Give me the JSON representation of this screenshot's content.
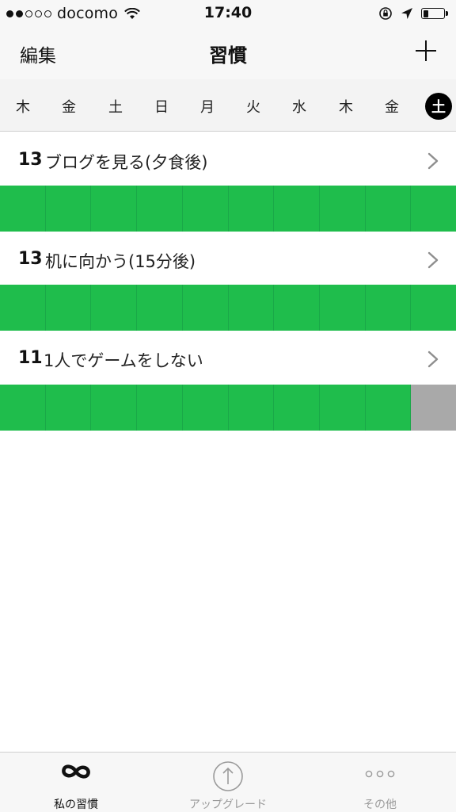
{
  "status_bar": {
    "carrier": "docomo",
    "time": "17:40",
    "signal_bars": 2,
    "battery_level": 0.25
  },
  "nav": {
    "edit_label": "編集",
    "title": "習慣"
  },
  "days": [
    {
      "label": "木",
      "today": false
    },
    {
      "label": "金",
      "today": false
    },
    {
      "label": "土",
      "today": false
    },
    {
      "label": "日",
      "today": false
    },
    {
      "label": "月",
      "today": false
    },
    {
      "label": "火",
      "today": false
    },
    {
      "label": "水",
      "today": false
    },
    {
      "label": "木",
      "today": false
    },
    {
      "label": "金",
      "today": false
    },
    {
      "label": "土",
      "today": true
    }
  ],
  "habits": [
    {
      "count": "13",
      "name": "ブログを見る(夕食後)",
      "days": [
        1,
        1,
        1,
        1,
        1,
        1,
        1,
        1,
        1,
        1
      ]
    },
    {
      "count": "13",
      "name": "机に向かう(15分後)",
      "days": [
        1,
        1,
        1,
        1,
        1,
        1,
        1,
        1,
        1,
        1
      ]
    },
    {
      "count": "11",
      "name": "1人でゲームをしない",
      "days": [
        1,
        1,
        1,
        1,
        1,
        1,
        1,
        1,
        1,
        0
      ]
    }
  ],
  "tabs": [
    {
      "label": "私の習慣",
      "icon": "infinity-icon",
      "active": true
    },
    {
      "label": "アップグレード",
      "icon": "upgrade-arrow-icon",
      "active": false
    },
    {
      "label": "その他",
      "icon": "more-dots-icon",
      "active": false
    }
  ],
  "colors": {
    "done": "#1fbd4c",
    "missed": "#a9a9a9",
    "today_badge": "#000000"
  }
}
